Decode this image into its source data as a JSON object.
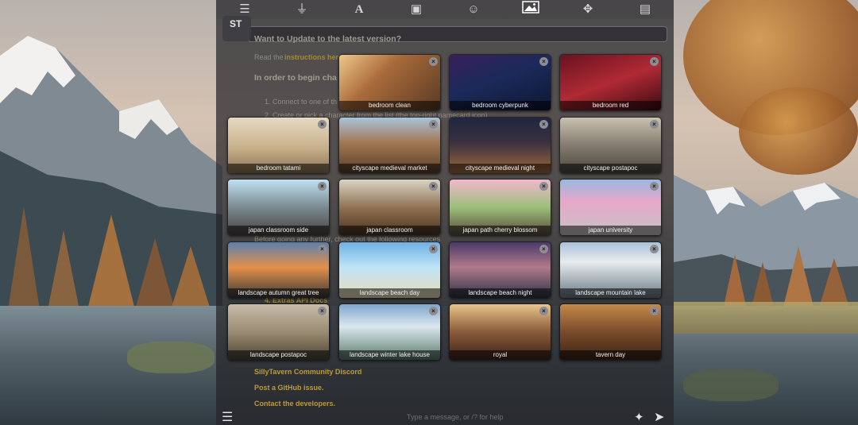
{
  "top_bar": {
    "icons": [
      "sliders-icon",
      "plug-icon",
      "text-format-icon",
      "book-icon",
      "smiley-icon",
      "image-icon",
      "extensions-icon",
      "id-card-icon"
    ],
    "active_icon": "image-icon"
  },
  "app": {
    "badge": "ST"
  },
  "welcome": {
    "update_heading": "Want to Update to the latest version?",
    "read_prefix": "Read the",
    "read_link": "instructions here",
    "begin_heading": "In order to begin cha",
    "step1": "1. Connect to one of th",
    "step2": "2. Create or pick a character from the list (the top-right namecard icon)",
    "resources": "Before going any further, check out the following resources",
    "extras_docs": "4. Extras API Docs",
    "discord": "SillyTavern Community Discord",
    "github": "Post a GitHub issue.",
    "contact": "Contact the developers."
  },
  "backgrounds": [
    {
      "label": "bedroom clean",
      "theme": "bedroom-clean"
    },
    {
      "label": "bedroom cyberpunk",
      "theme": "bedroom-cyberpunk"
    },
    {
      "label": "bedroom red",
      "theme": "bedroom-red"
    },
    {
      "label": "bedroom tatami",
      "theme": "bedroom-tatami"
    },
    {
      "label": "cityscape medieval market",
      "theme": "medieval-market"
    },
    {
      "label": "cityscape medieval night",
      "theme": "medieval-night"
    },
    {
      "label": "cityscape postapoc",
      "theme": "city-postapoc"
    },
    {
      "label": "japan classroom side",
      "theme": "classroom-side"
    },
    {
      "label": "japan classroom",
      "theme": "classroom"
    },
    {
      "label": "japan path cherry blossom",
      "theme": "cherry-path"
    },
    {
      "label": "japan university",
      "theme": "university"
    },
    {
      "label": "landscape autumn great tree",
      "theme": "autumn-tree"
    },
    {
      "label": "landscape beach day",
      "theme": "beach-day"
    },
    {
      "label": "landscape beach night",
      "theme": "beach-night"
    },
    {
      "label": "landscape mountain lake",
      "theme": "mountain-lake"
    },
    {
      "label": "landscape postapoc",
      "theme": "land-postapoc"
    },
    {
      "label": "landscape winter lake house",
      "theme": "winter-lake"
    },
    {
      "label": "royal",
      "theme": "royal"
    },
    {
      "label": "tavern day",
      "theme": "tavern-day"
    }
  ],
  "delete_glyph": "×",
  "input": {
    "placeholder": "Type a message, or /? for help"
  },
  "colors": {
    "accent_link": "#c09a32",
    "panel_bg": "#28282c"
  }
}
